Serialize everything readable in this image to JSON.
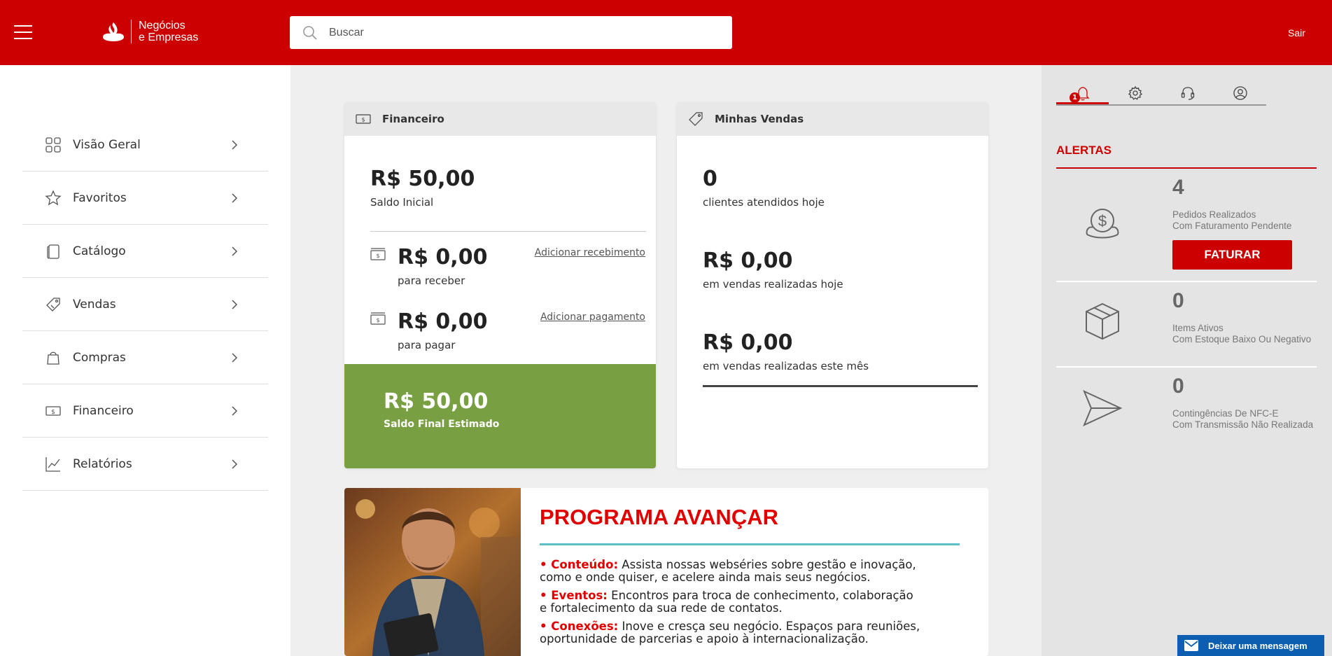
{
  "header": {
    "logo_line1": "Negócios",
    "logo_line2": "e Empresas",
    "search_placeholder": "Buscar",
    "logout_label": "Sair",
    "brand_color": "#cc0000"
  },
  "sidebar": {
    "items": [
      {
        "label": "Visão Geral",
        "icon": "grid-icon"
      },
      {
        "label": "Favoritos",
        "icon": "star-icon"
      },
      {
        "label": "Catálogo",
        "icon": "catalog-icon"
      },
      {
        "label": "Vendas",
        "icon": "tag-icon"
      },
      {
        "label": "Compras",
        "icon": "shopping-bag-icon"
      },
      {
        "label": "Financeiro",
        "icon": "money-icon"
      },
      {
        "label": "Relatórios",
        "icon": "chart-icon"
      }
    ]
  },
  "financeiro": {
    "title": "Financeiro",
    "saldo_inicial_value": "R$ 50,00",
    "saldo_inicial_label": "Saldo Inicial",
    "receber_value": "R$ 0,00",
    "receber_label": "para receber",
    "receber_link": "Adicionar recebimento",
    "pagar_value": "R$ 0,00",
    "pagar_label": "para pagar",
    "pagar_link": "Adicionar pagamento",
    "saldo_final_value": "R$ 50,00",
    "saldo_final_label": "Saldo Final Estimado",
    "green_color": "#78a042"
  },
  "vendas": {
    "title": "Minhas Vendas",
    "clientes_value": "0",
    "clientes_label": "clientes atendidos hoje",
    "hoje_value": "R$ 0,00",
    "hoje_label": "em vendas realizadas hoje",
    "mes_value": "R$ 0,00",
    "mes_label": "em vendas realizadas este mês"
  },
  "promo": {
    "title": "PROGRAMA AVANÇAR",
    "items": [
      {
        "label": "• Conteúdo:",
        "line1": " Assista nossas webséries sobre gestão e inovação,",
        "line2": "como e onde quiser, e acelere ainda mais seus negócios."
      },
      {
        "label": "• Eventos:",
        "line1": " Encontros para troca de conhecimento, colaboração",
        "line2": "e fortalecimento da sua rede de contatos."
      },
      {
        "label": "• Conexões:",
        "line1": " Inove e cresça seu negócio. Espaços para reuniões,",
        "line2": "oportunidade de parcerias e apoio à internacionalização."
      }
    ]
  },
  "right_panel": {
    "tabs": [
      "bell-icon",
      "gear-icon",
      "headset-icon",
      "user-icon"
    ],
    "notification_count": "1",
    "alerts_title": "ALERTAS",
    "alerts": [
      {
        "count": "4",
        "line1": "Pedidos Realizados",
        "line2": "Com Faturamento Pendente",
        "button": "FATURAR",
        "icon": "money-bag-icon"
      },
      {
        "count": "0",
        "line1": "Items Ativos",
        "line2": "Com Estoque Baixo Ou Negativo",
        "icon": "box-icon"
      },
      {
        "count": "0",
        "line1": "Contingências De NFC-E",
        "line2": "Com Transmissão Não Realizada",
        "icon": "send-icon"
      }
    ]
  },
  "chat": {
    "label": "Deixar uma mensagem"
  }
}
